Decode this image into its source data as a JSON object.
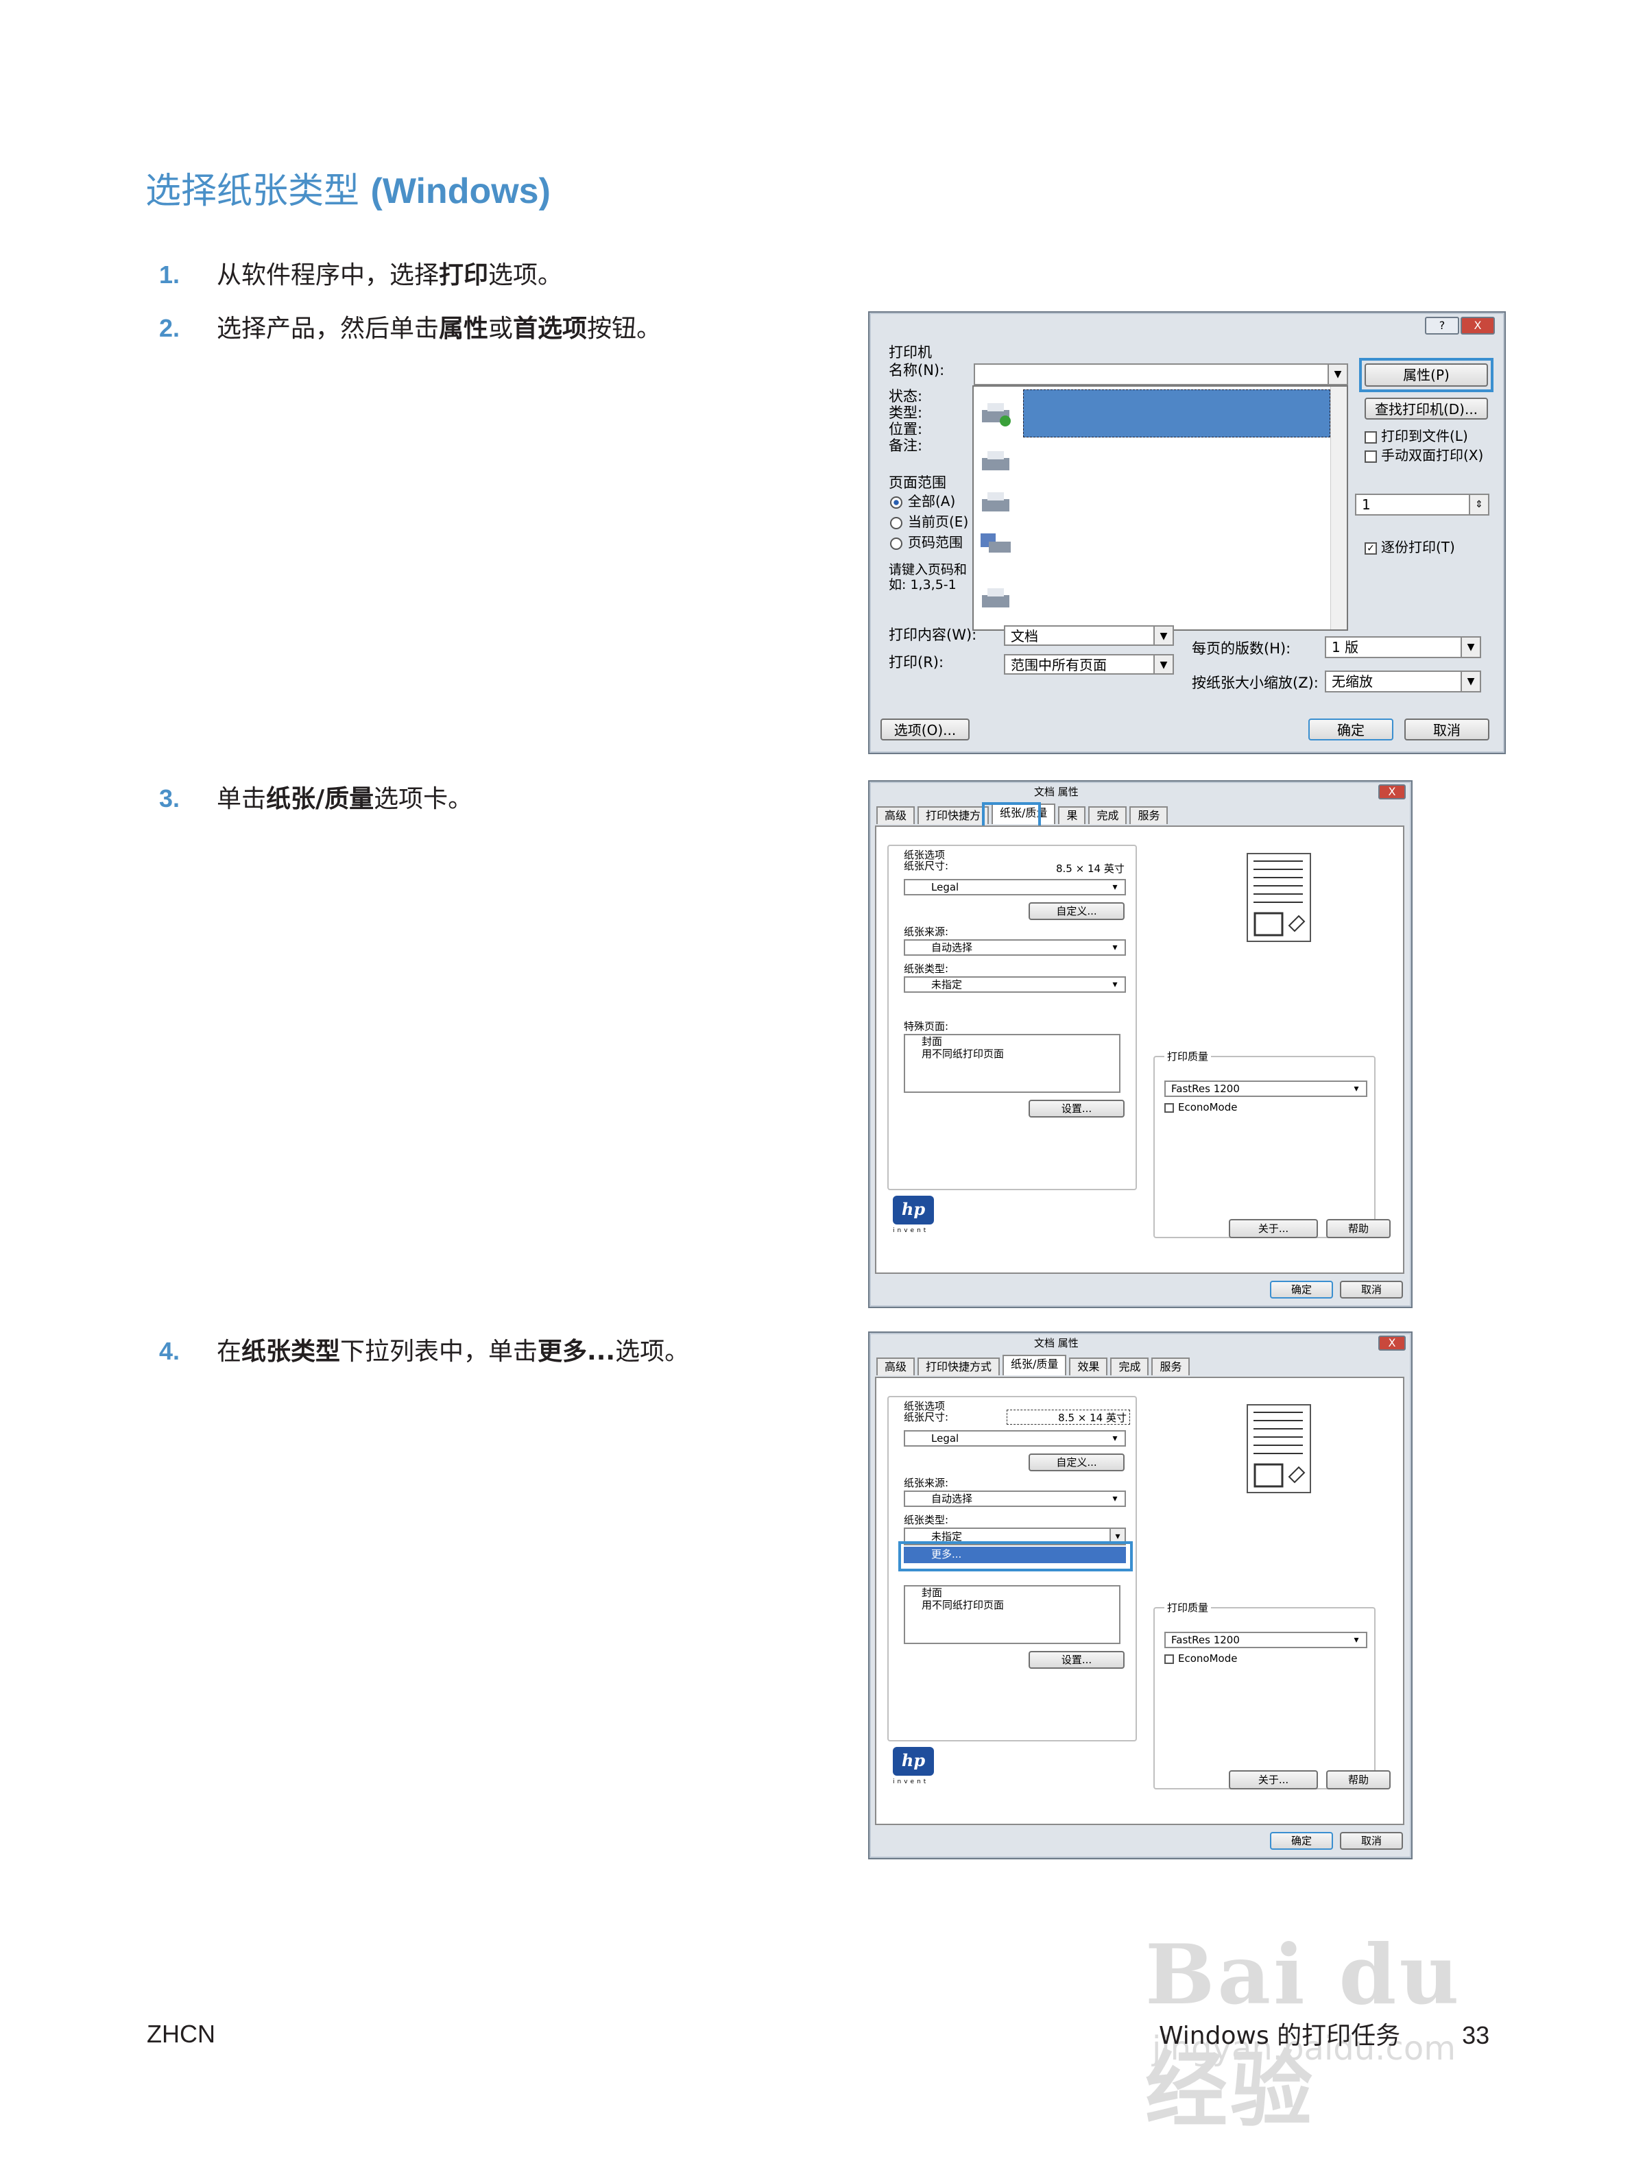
{
  "page": {
    "title_cn": "选择纸张类型",
    "title_en": "(Windows)",
    "footer_left": "ZHCN",
    "footer_right": "Windows 的打印任务",
    "page_number": "33",
    "watermark_main": "Bai du 经验",
    "watermark_url": "jingyan.baidu.com"
  },
  "steps": [
    {
      "num": "1.",
      "pre": "从软件程序中，选择",
      "b1": "打印",
      "post": "选项。"
    },
    {
      "num": "2.",
      "pre": "选择产品，然后单击",
      "b1": "属性",
      "mid": "或",
      "b2": "首选项",
      "post": "按钮。"
    },
    {
      "num": "3.",
      "pre": "单击",
      "b1": "纸张/质量",
      "post": "选项卡。"
    },
    {
      "num": "4.",
      "pre": "在",
      "b1": "纸张类型",
      "mid": "下拉列表中，单击",
      "b2": "更多...",
      "post": "选项。"
    }
  ],
  "print_dialog": {
    "title_help": "?",
    "title_close": "X",
    "group_printer": "打印机",
    "name_label": "名称(N):",
    "status_label": "状态:",
    "type_label": "类型:",
    "location_label": "位置:",
    "comment_label": "备注:",
    "properties_button": "属性(P)",
    "find_printer_button": "查找打印机(D)...",
    "print_to_file": "打印到文件(L)",
    "manual_duplex": "手动双面打印(X)",
    "page_range": "页面范围",
    "all": "全部(A)",
    "current_page": "当前页(E)",
    "pages": "页码范围",
    "hint1": "请键入页码和",
    "hint2": "如: 1,3,5-1",
    "copies_value": "1",
    "collate": "逐份打印(T)",
    "print_what_label": "打印内容(W):",
    "print_what_value": "文档",
    "print_label": "打印(R):",
    "print_value": "范围中所有页面",
    "pages_per_sheet_label": "每页的版数(H):",
    "pages_per_sheet_value": "1 版",
    "scale_label": "按纸张大小缩放(Z):",
    "scale_value": "无缩放",
    "options_button": "选项(O)...",
    "ok": "确定",
    "cancel": "取消"
  },
  "props_dialog": {
    "title": "文档 属性",
    "tabs": [
      "高级",
      "打印快捷方式",
      "纸张/质量",
      "效果",
      "完成",
      "服务"
    ],
    "tab_short_2": "打印快捷方",
    "tab_short_4": "果",
    "paper_options": "纸张选项",
    "paper_size_label": "纸张尺寸:",
    "paper_size_value": "8.5 × 14 英寸",
    "paper_size_select": "Legal",
    "custom_button": "自定义...",
    "source_label": "纸张来源:",
    "source_value": "自动选择",
    "type_label": "纸张类型:",
    "type_value": "未指定",
    "more_option": "更多...",
    "special_pages": "特殊页面:",
    "special_1": "封面",
    "special_2": "用不同纸打印页面",
    "settings_button": "设置...",
    "print_quality": "打印质量",
    "quality_value": "FastRes 1200",
    "econo_mode": "EconoMode",
    "hp_logo": "hp",
    "hp_invent": "invent",
    "about_button": "关于...",
    "help_button": "帮助",
    "ok": "确定",
    "cancel": "取消"
  }
}
